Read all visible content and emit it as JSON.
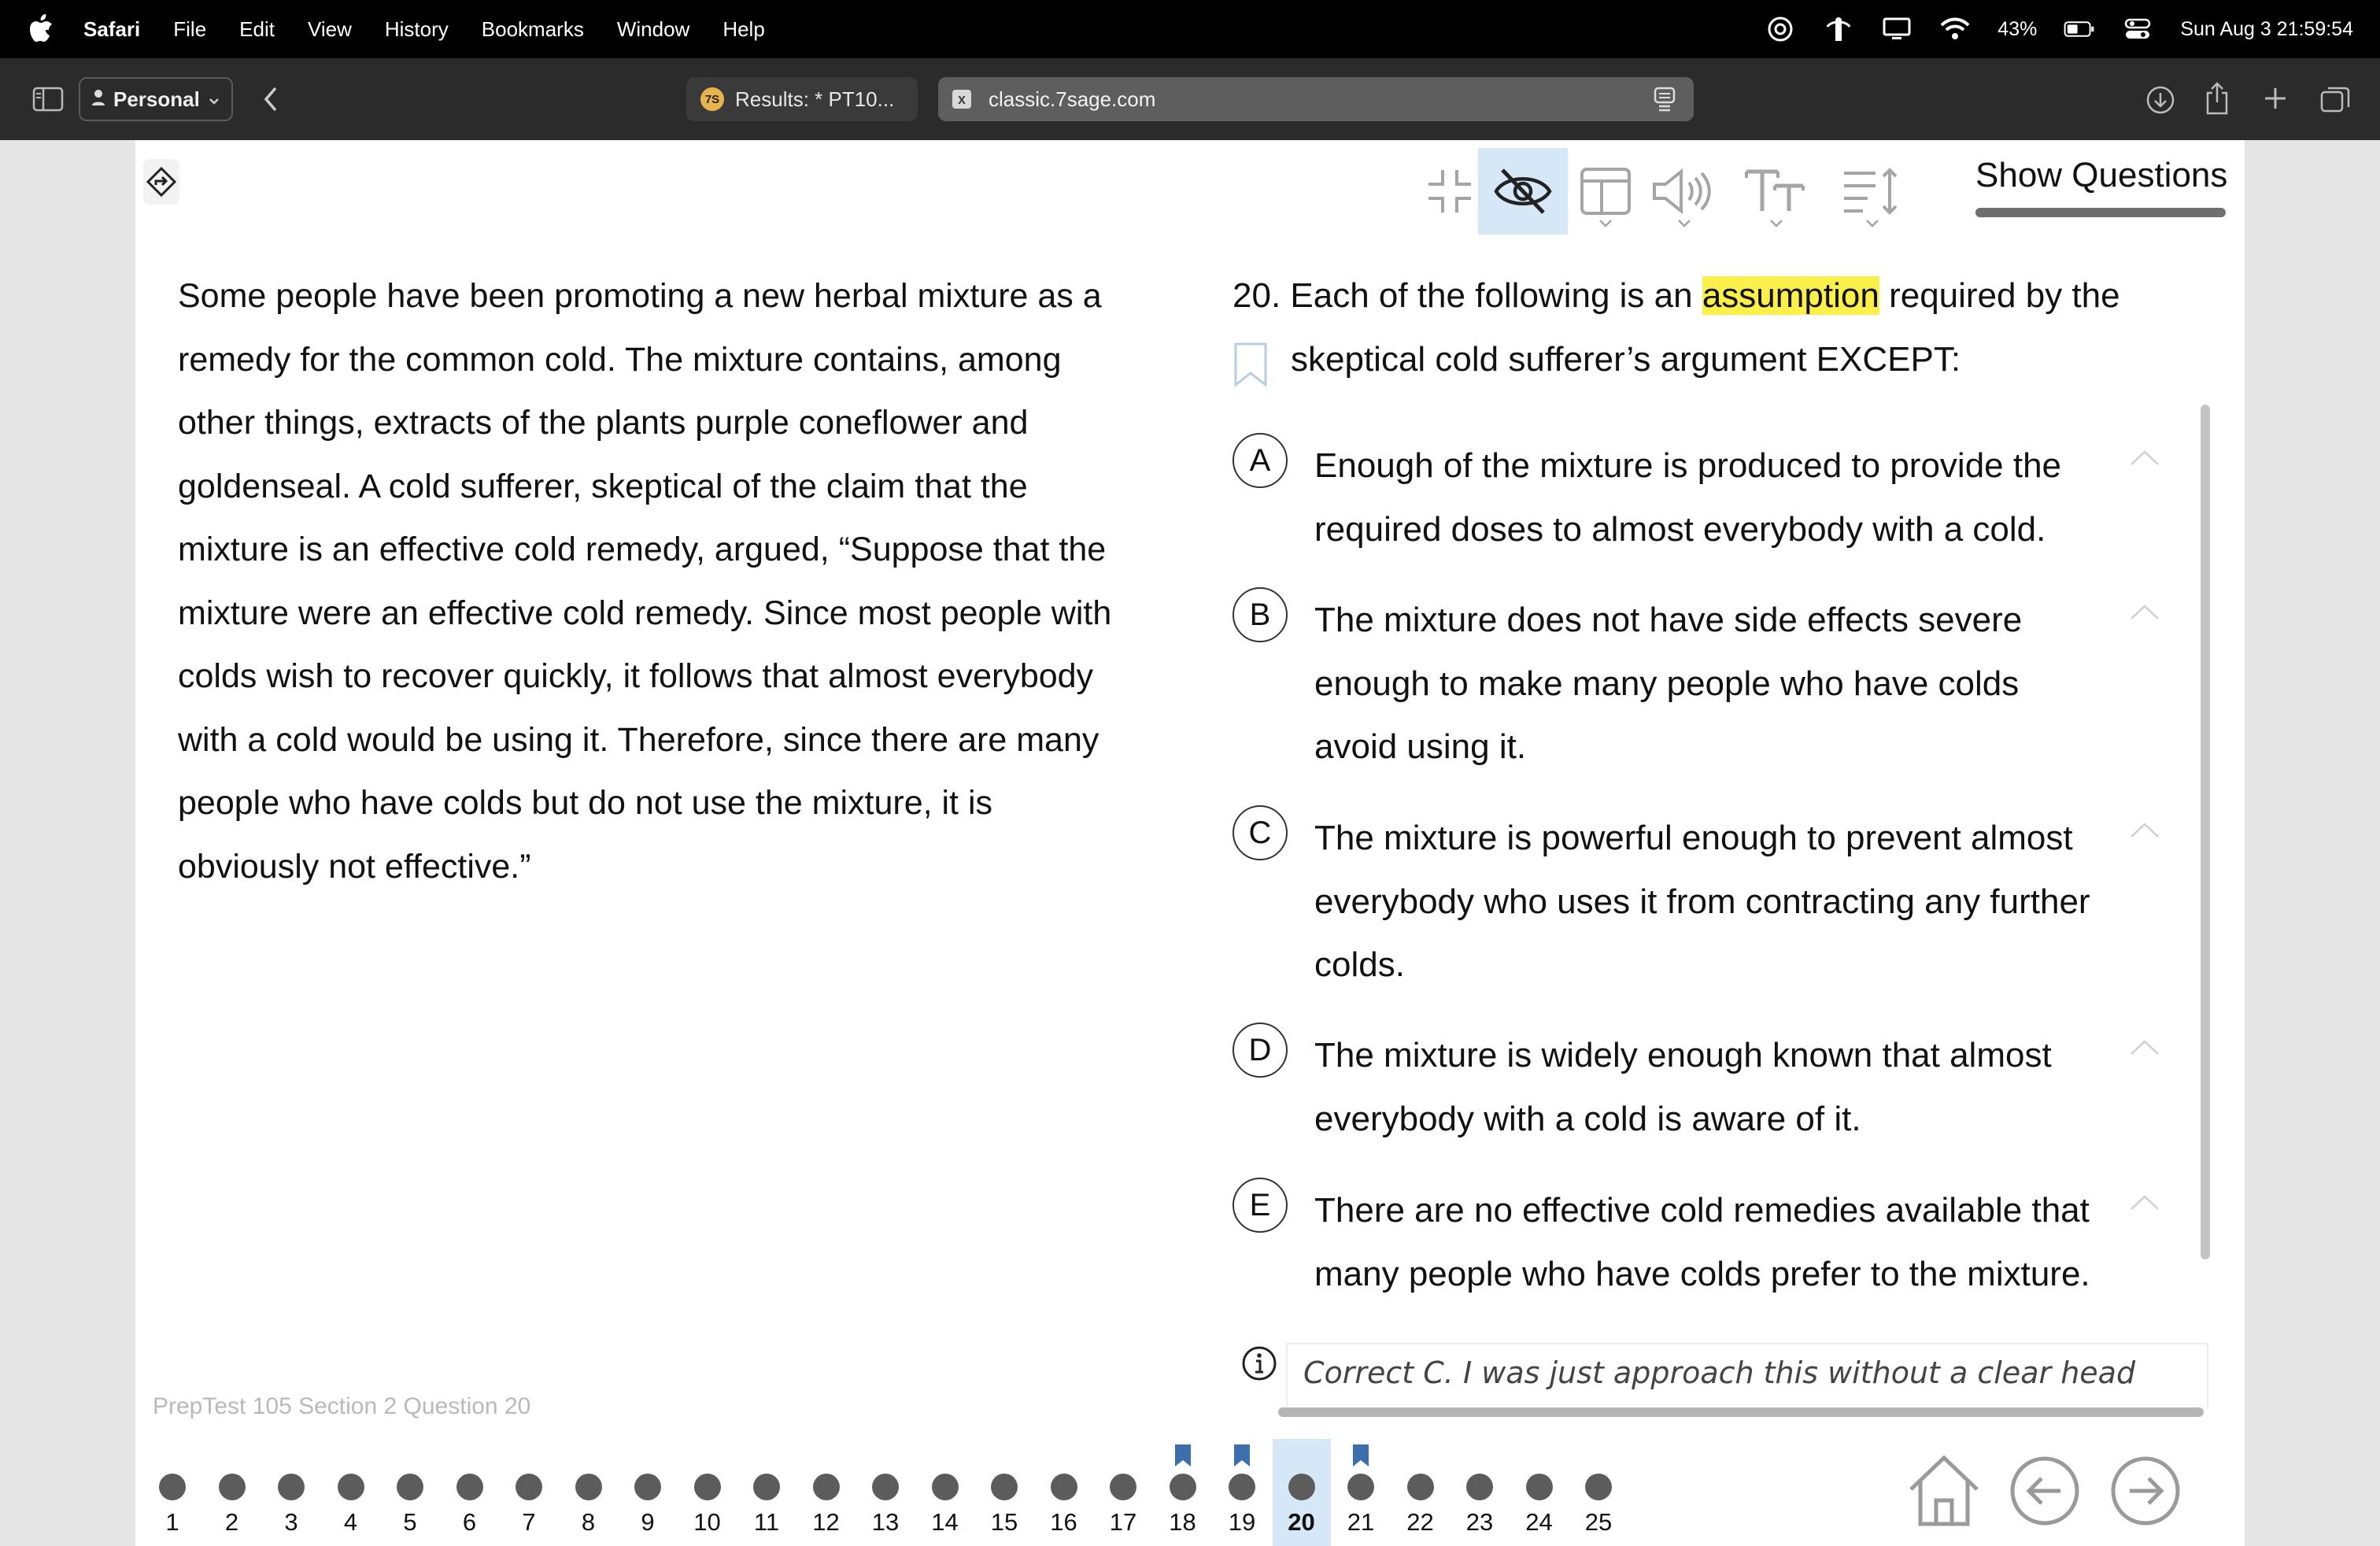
{
  "menubar": {
    "items": [
      "Safari",
      "File",
      "Edit",
      "View",
      "History",
      "Bookmarks",
      "Window",
      "Help"
    ],
    "battery": "43%",
    "clock": "Sun Aug 3  21:59:54"
  },
  "safari": {
    "profile": "Personal",
    "tabs": [
      {
        "favicon": "7S",
        "title": "Results: * PT10..."
      },
      {
        "favicon": "x",
        "title": "classic.7sage.com"
      }
    ]
  },
  "toolbar": {
    "show_questions": "Show Questions"
  },
  "passage": {
    "lines": [
      "Some people have been promoting a new herbal mixture as a",
      "remedy for the common cold. The mixture contains, among",
      "other things, extracts of the plants purple coneflower and",
      "goldenseal. A cold sufferer, skeptical of the claim that the",
      "mixture is an effective cold remedy, argued, “Suppose that the",
      "mixture were an effective cold remedy. Since most people with",
      "colds wish to recover quickly, it follows that almost everybody",
      "with a cold would be using it. Therefore, since there are many",
      "people who have colds but do not use the mixture, it is",
      "obviously not effective.”"
    ],
    "source": "PrepTest 105 Section 2 Question 20"
  },
  "question": {
    "prefix": "20. Each of the following is an",
    "highlight": "assumption",
    "suffix": " required by the",
    "line2": "skeptical cold sufferer’s argument EXCEPT:"
  },
  "choices": [
    {
      "letter": "A",
      "lines": [
        "Enough of the mixture is produced to provide the",
        "required doses to almost everybody with a cold."
      ]
    },
    {
      "letter": "B",
      "lines": [
        "The mixture does not have side effects severe",
        "enough to make many people who have colds",
        "avoid using it."
      ]
    },
    {
      "letter": "C",
      "lines": [
        "The mixture is powerful enough to prevent almost",
        "everybody who uses it from contracting any further",
        "colds."
      ]
    },
    {
      "letter": "D",
      "lines": [
        "The mixture is widely enough known that almost",
        "everybody with a cold is aware of it."
      ]
    },
    {
      "letter": "E",
      "lines": [
        "There are no effective cold remedies available that",
        "many people who have colds prefer to the mixture."
      ]
    }
  ],
  "note": "Correct C. I was just approach this without a clear head",
  "nav": {
    "questions": [
      "1",
      "2",
      "3",
      "4",
      "5",
      "6",
      "7",
      "8",
      "9",
      "10",
      "11",
      "12",
      "13",
      "14",
      "15",
      "16",
      "17",
      "18",
      "19",
      "20",
      "21",
      "22",
      "23",
      "24",
      "25"
    ],
    "current": "20",
    "flagged": [
      "18",
      "19",
      "21"
    ],
    "flag_color": "#3d6fae"
  }
}
